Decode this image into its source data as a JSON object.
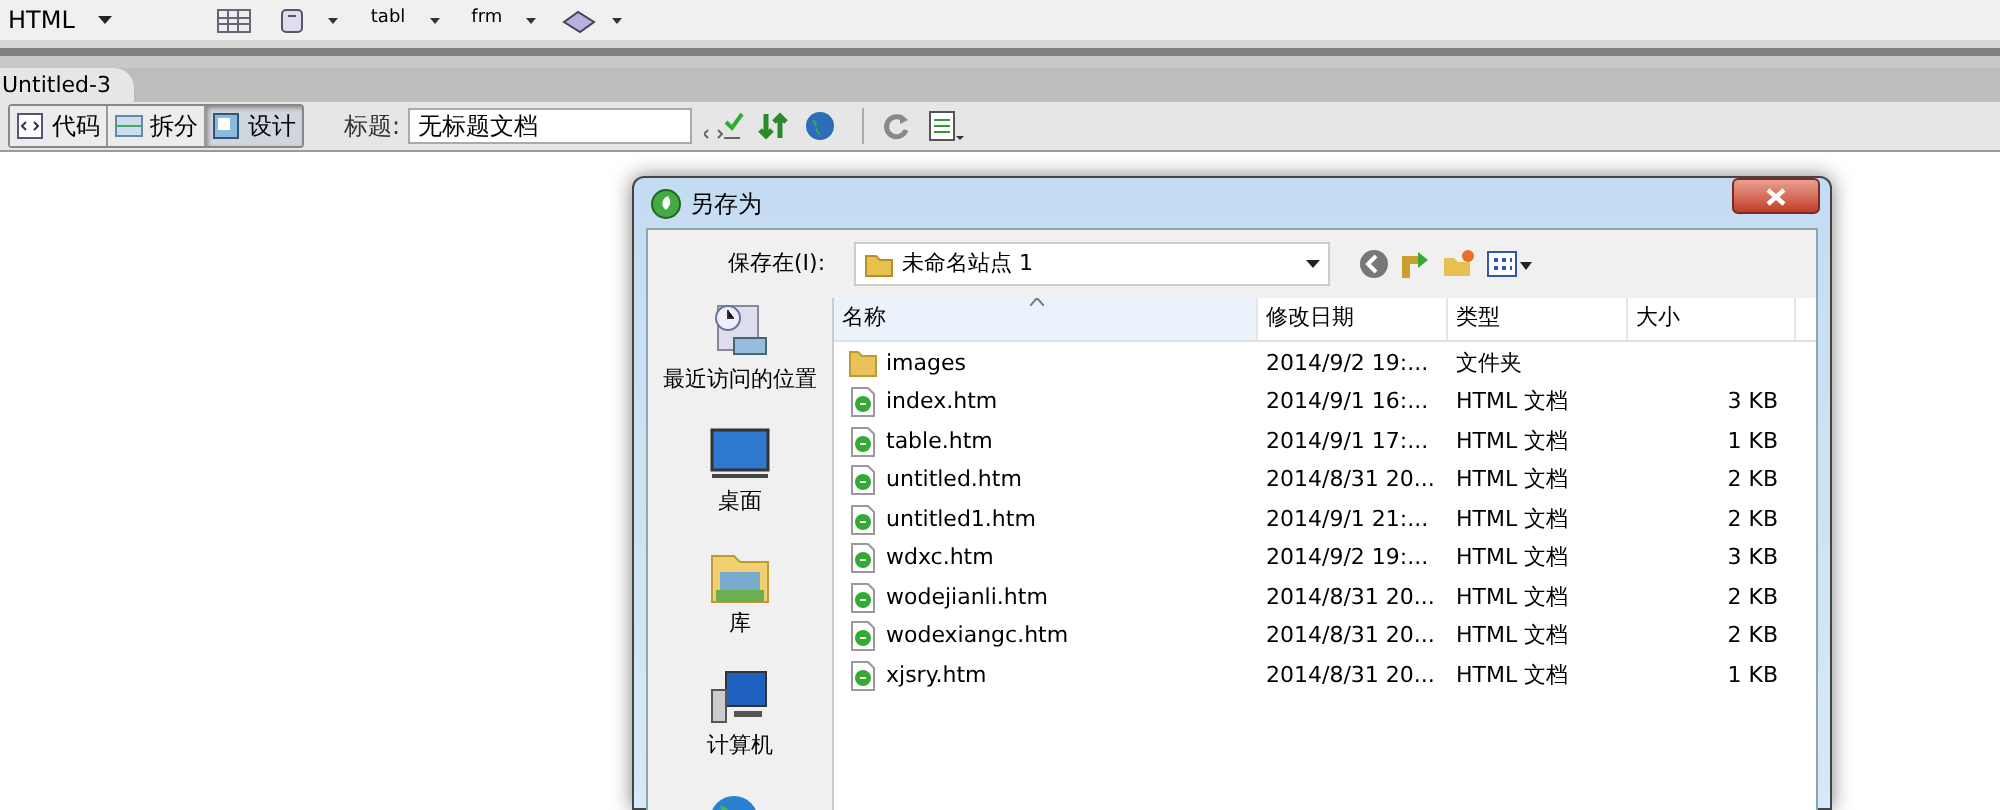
{
  "insert_bar": {
    "category": "HTML",
    "tools": [
      {
        "kind": "table-icon"
      },
      {
        "kind": "image-icon",
        "menu": true
      },
      {
        "kind": "text",
        "label": "tabl",
        "menu": true
      },
      {
        "kind": "text",
        "label": "frm",
        "menu": true
      },
      {
        "kind": "book-icon",
        "menu": true
      }
    ]
  },
  "document_tab": {
    "label": "Untitled-3",
    "selected": true
  },
  "view_buttons": [
    {
      "label": "代码",
      "kind": "code",
      "selected": false
    },
    {
      "label": "拆分",
      "kind": "split",
      "selected": false
    },
    {
      "label": "设计",
      "kind": "design",
      "selected": true
    }
  ],
  "title_label": "标题:",
  "title_field": {
    "value": "无标题文档"
  },
  "dialog": {
    "title": "另存为",
    "save_in_label": "保存在(I):",
    "location": "未命名站点 1",
    "places": [
      {
        "label": "最近访问的位置",
        "kind": "recent"
      },
      {
        "label": "桌面",
        "kind": "desktop"
      },
      {
        "label": "库",
        "kind": "library"
      },
      {
        "label": "计算机",
        "kind": "computer"
      },
      {
        "kind": "network"
      }
    ],
    "columns": [
      {
        "label": "名称",
        "sorted": true
      },
      {
        "label": "修改日期",
        "sorted": false
      },
      {
        "label": "类型",
        "sorted": false
      },
      {
        "label": "大小",
        "sorted": false
      }
    ],
    "rows": [
      {
        "kind": "folder",
        "name": "images",
        "date": "2014/9/2 19:...",
        "type": "文件夹"
      },
      {
        "kind": "file",
        "name": "index.htm",
        "date": "2014/9/1 16:...",
        "type": "HTML 文档",
        "size": "3 KB"
      },
      {
        "kind": "file",
        "name": "table.htm",
        "date": "2014/9/1 17:...",
        "type": "HTML 文档",
        "size": "1 KB"
      },
      {
        "kind": "file",
        "name": "untitled.htm",
        "date": "2014/8/31 20...",
        "type": "HTML 文档",
        "size": "2 KB"
      },
      {
        "kind": "file",
        "name": "untitled1.htm",
        "date": "2014/9/1 21:...",
        "type": "HTML 文档",
        "size": "2 KB"
      },
      {
        "kind": "file",
        "name": "wdxc.htm",
        "date": "2014/9/2 19:...",
        "type": "HTML 文档",
        "size": "3 KB"
      },
      {
        "kind": "file",
        "name": "wodejianli.htm",
        "date": "2014/8/31 20...",
        "type": "HTML 文档",
        "size": "2 KB"
      },
      {
        "kind": "file",
        "name": "wodexiangc.htm",
        "date": "2014/8/31 20...",
        "type": "HTML 文档",
        "size": "2 KB"
      },
      {
        "kind": "file",
        "name": "xjsry.htm",
        "date": "2014/8/31 20...",
        "type": "HTML 文档",
        "size": "1 KB"
      }
    ]
  }
}
